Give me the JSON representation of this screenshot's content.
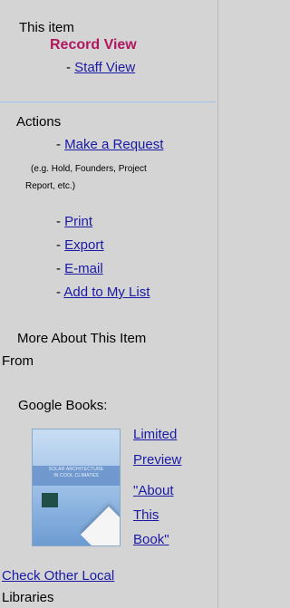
{
  "this_item": {
    "heading": "This item",
    "record_view": "Record View",
    "staff_view": "Staff View"
  },
  "actions": {
    "heading": "Actions",
    "items": [
      {
        "label": "Make a Request"
      },
      {
        "label": "Print"
      },
      {
        "label": "Export"
      },
      {
        "label": "E-mail"
      },
      {
        "label": "Add to My List"
      }
    ],
    "request_note_line1": "(e.g. Hold, Founders, Project",
    "request_note_line2": "Report, etc.)"
  },
  "more_about": {
    "heading_line1": "More About This Item",
    "heading_line2": "From"
  },
  "google_books": {
    "label": "Google Books:",
    "cover_text_line1": "SOLAR ARCHITECTURE",
    "cover_text_line2": "IN COOL CLIMATES",
    "links": [
      {
        "line": "Limited"
      },
      {
        "line": "Preview"
      },
      {
        "line": "\"About"
      },
      {
        "line": "This"
      },
      {
        "line": "Book\""
      }
    ]
  },
  "check_other": {
    "line1": "Check Other Local",
    "line2": "Libraries"
  },
  "colors": {
    "background": "#d4d4d4",
    "link": "#1a1aa6",
    "record_view": "#b0175f",
    "divider": "#9fc6e6"
  }
}
